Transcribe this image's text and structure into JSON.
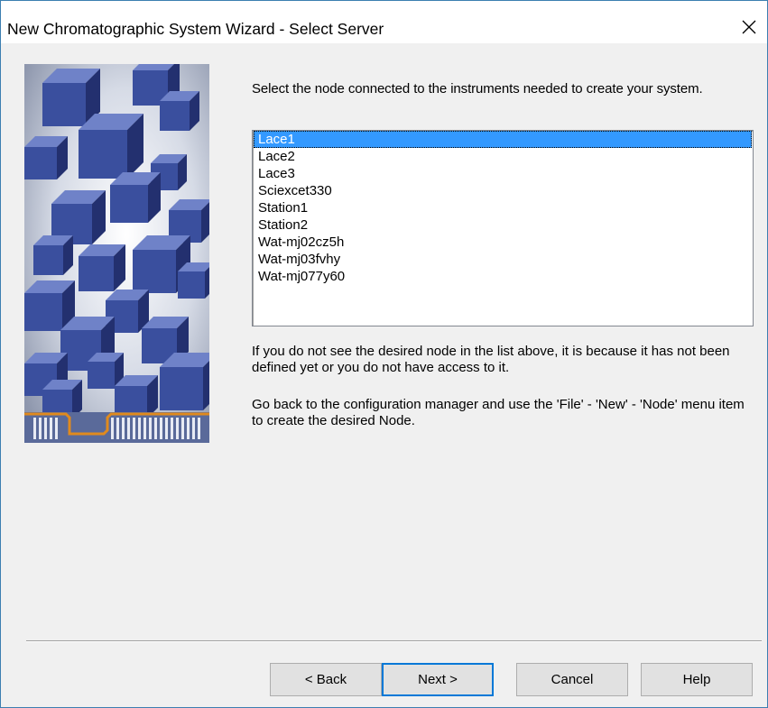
{
  "window": {
    "title": "New Chromatographic System Wizard - Select Server",
    "close_icon": "close-icon"
  },
  "banner": {
    "icon": "cubes-banner-image"
  },
  "prompt": "Select the node connected to the instruments needed to create your system.",
  "nodes": {
    "selected_index": 0,
    "items": [
      "Lace1",
      "Lace2",
      "Lace3",
      "Sciexcet330",
      "Station1",
      "Station2",
      "Wat-mj02cz5h",
      "Wat-mj03fvhy",
      "Wat-mj077y60"
    ]
  },
  "info": {
    "line1": "If you do not see the desired node in the list above, it is because it has not been defined yet or you do not have access to it.",
    "line2": "Go back to the configuration manager and use the 'File' - 'New' - 'Node' menu item to create the desired Node."
  },
  "buttons": {
    "back": "< Back",
    "next": "Next >",
    "cancel": "Cancel",
    "help": "Help"
  },
  "colors": {
    "selection": "#3399ff",
    "cube_blue": "#3a4f9e",
    "accent_orange": "#e08a1e"
  }
}
